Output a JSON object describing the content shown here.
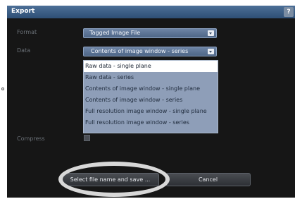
{
  "dialog": {
    "title": "Export",
    "help_label": "?"
  },
  "format": {
    "label": "Format",
    "value": "Tagged Image File"
  },
  "data_field": {
    "label": "Data",
    "value": "Contents of image window - series",
    "options": [
      "Raw data - single plane",
      "Raw data - series",
      "Contents of image window - single plane",
      "Contents of image window - series",
      "Full resolution image window - single plane",
      "Full resolution image window - series"
    ],
    "highlighted_index": 0
  },
  "compress": {
    "label": "Compress",
    "checked": false
  },
  "buttons": {
    "save": "Select file name and save ...",
    "cancel": "Cancel"
  }
}
